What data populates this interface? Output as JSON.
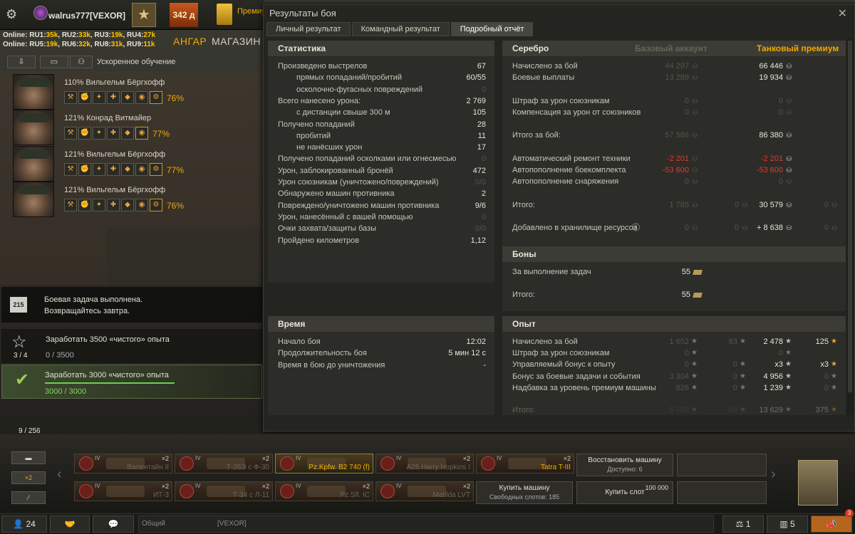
{
  "topbar": {
    "username": "walrus777[VEXOR]",
    "premium_days": "342 д",
    "premium_text": "Премиу магазин",
    "online_row1": [
      {
        "k": "RU1:",
        "v": "35k"
      },
      {
        "k": "RU2:",
        "v": "33k"
      },
      {
        "k": "RU3:",
        "v": "19k"
      },
      {
        "k": "RU4:",
        "v": "27k"
      }
    ],
    "online_row2": [
      {
        "k": "RU5:",
        "v": "19k"
      },
      {
        "k": "RU6:",
        "v": "32k"
      },
      {
        "k": "RU8:",
        "v": "31k"
      },
      {
        "k": "RU9:",
        "v": "11k"
      }
    ],
    "online_label": "Online:",
    "tab_hangar": "АНГАР",
    "tab_shop": "МАГАЗИН"
  },
  "crew_bar": {
    "accelerated": "Ускоренное обучение"
  },
  "crew": [
    {
      "name": "110% Вильгельм Бёргхофф",
      "pct": "76%"
    },
    {
      "name": "121% Конрад Витмайер",
      "pct": "77%"
    },
    {
      "name": "121% Вильгельм Бёргхофф",
      "pct": "77%"
    },
    {
      "name": "121% Вильгельм Бёргхофф",
      "pct": "76%"
    }
  ],
  "missions": {
    "daily_icon": "215",
    "daily_line1": "Боевая задача выполнена.",
    "daily_line2": "Возвращайтесь завтра.",
    "m2_title": "Заработать 3500 «чистого» опыта",
    "m2_count": "3 / 4",
    "m2_progress": "0 / 3500",
    "m3_title": "Заработать 3000 «чистого» опыта",
    "m3_progress": "3000 / 3000"
  },
  "window": {
    "title": "Результаты боя",
    "tabs": [
      "Личный результат",
      "Командный результат",
      "Подробный отчёт"
    ],
    "active_tab": 2
  },
  "stats": {
    "header": "Статистика",
    "rows": [
      {
        "label": "Произведено выстрелов",
        "value": "67",
        "indent": false,
        "dim": false
      },
      {
        "label": "прямых попаданий/пробитий",
        "value": "60/55",
        "indent": true,
        "dim": false
      },
      {
        "label": "осколочно-фугасных повреждений",
        "value": "0",
        "indent": true,
        "dim": true
      },
      {
        "label": "Всего нанесено урона:",
        "value": "2 769",
        "indent": false,
        "dim": false
      },
      {
        "label": "с дистанции свыше 300 м",
        "value": "105",
        "indent": true,
        "dim": false
      },
      {
        "label": "Получено попаданий",
        "value": "28",
        "indent": false,
        "dim": false
      },
      {
        "label": "пробитий",
        "value": "11",
        "indent": true,
        "dim": false
      },
      {
        "label": "не нанёсших урон",
        "value": "17",
        "indent": true,
        "dim": false
      },
      {
        "label": "Получено попаданий осколками или огнесмесью",
        "value": "0",
        "indent": false,
        "dim": true
      },
      {
        "label": "Урон, заблокированный бронёй",
        "value": "472",
        "indent": false,
        "dim": false
      },
      {
        "label": "Урон союзникам (уничтожено/повреждений)",
        "value": "0/0",
        "indent": false,
        "dim": true
      },
      {
        "label": "Обнаружено машин противника",
        "value": "2",
        "indent": false,
        "dim": false
      },
      {
        "label": "Повреждено/уничтожено машин противника",
        "value": "9/6",
        "indent": false,
        "dim": false
      },
      {
        "label": "Урон, нанесённый с вашей помощью",
        "value": "0",
        "indent": false,
        "dim": true
      },
      {
        "label": "Очки захвата/защиты базы",
        "value": "0/0",
        "indent": false,
        "dim": true
      },
      {
        "label": "Пройдено километров",
        "value": "1,12",
        "indent": false,
        "dim": false
      }
    ]
  },
  "time": {
    "header": "Время",
    "rows": [
      {
        "label": "Начало боя",
        "value": "12:02"
      },
      {
        "label": "Продолжительность боя",
        "value": "5 мин 12 с"
      },
      {
        "label": "Время в бою до уничтожения",
        "value": "-"
      }
    ]
  },
  "silver": {
    "header": "Серебро",
    "col_base": "Базовый аккаунт",
    "col_prem": "Танковый премиум",
    "rows": [
      {
        "label": "Начислено за бой",
        "base": "44 297",
        "prem": "66 446",
        "gap": false
      },
      {
        "label": "Боевые выплаты",
        "base": "13 289",
        "prem": "19 934",
        "gap": false
      },
      {
        "label": "Штраф за урон союзникам",
        "base": "0",
        "prem": "0",
        "gap": true
      },
      {
        "label": "Компенсация за урон от союзников",
        "base": "0",
        "prem": "0",
        "gap": false
      },
      {
        "label": "Итого за бой:",
        "base": "57 586",
        "prem": "86 380",
        "gap": true
      },
      {
        "label": "Автоматический ремонт техники",
        "base": "-2 201",
        "prem": "-2 201",
        "gap": true
      },
      {
        "label": "Автопополнение боекомплекта",
        "base": "-53 600",
        "prem": "-53 600",
        "gap": false
      },
      {
        "label": "Автопополнение снаряжения",
        "base": "0",
        "prem": "0",
        "gap": false
      },
      {
        "label": "Итого:",
        "base": "1 785",
        "base2": "0",
        "prem": "30 579",
        "prem2": "0",
        "gap": true
      },
      {
        "label": "Добавлено в хранилище ресурсов",
        "base": "0",
        "base2": "0",
        "prem": "+ 8 638",
        "prem2": "0",
        "gap": true
      }
    ]
  },
  "bons": {
    "header": "Боны",
    "rows": [
      {
        "label": "За выполнение задач",
        "value": "55"
      },
      {
        "label": "Итого:",
        "value": "55"
      }
    ]
  },
  "exp": {
    "header": "Опыт",
    "rows": [
      {
        "label": "Начислено за бой",
        "b1": "1 652",
        "b2": "83",
        "p1": "2 478",
        "p2": "125"
      },
      {
        "label": "Штраф за урон союзникам",
        "b1": "0",
        "b2": "",
        "p1": "0",
        "p2": ""
      },
      {
        "label": "Управляемый бонус к опыту",
        "b1": "0",
        "b2": "0",
        "p1": "x3",
        "p2": "x3"
      },
      {
        "label": "Бонус за боевые задачи и события",
        "b1": "3 304",
        "b2": "0",
        "p1": "4 956",
        "p2": "0"
      },
      {
        "label": "Надбавка за уровень премиум машины",
        "b1": "826",
        "b2": "0",
        "p1": "1 239",
        "p2": "0"
      },
      {
        "label": "Итого:",
        "b1": "5 782",
        "b2": "83",
        "p1": "13 629",
        "p2": "375"
      }
    ]
  },
  "carousel": {
    "slots": "9 / 256",
    "side_x2": "×2",
    "vehicles_row1": [
      {
        "tier": "IV",
        "name": "Валентайн II",
        "x2": "×2",
        "cls": ""
      },
      {
        "tier": "IV",
        "name": "Т-28Э с Ф-30",
        "x2": "×2",
        "cls": ""
      },
      {
        "tier": "IV",
        "name": "Pz.Kpfw. B2 740 (f)",
        "x2": "",
        "cls": "sel"
      },
      {
        "tier": "IV",
        "name": "A25 Harry Hopkins I",
        "x2": "×2",
        "cls": ""
      },
      {
        "tier": "IV",
        "name": "Tatra T-III",
        "x2": "×2",
        "cls": "prem"
      }
    ],
    "vehicles_row2": [
      {
        "tier": "IV",
        "name": "ИТ-3",
        "x2": "×2",
        "cls": ""
      },
      {
        "tier": "IV",
        "name": "Т-34 с Л-11",
        "x2": "×2",
        "cls": ""
      },
      {
        "tier": "IV",
        "name": "Pz.Sfl. IC",
        "x2": "×2",
        "cls": ""
      },
      {
        "tier": "IV",
        "name": "Matilda LVT",
        "x2": "×2",
        "cls": ""
      }
    ],
    "restore": {
      "label": "Восстановить машину",
      "sub": "Доступно: 6"
    },
    "buy_vehicle": {
      "label": "Купить машину",
      "sub": "Свободных слотов: 185"
    },
    "buy_slot": {
      "label": "Купить слот",
      "price": "100 000"
    }
  },
  "bottombar": {
    "players": "24",
    "chat_general": "Общий",
    "chat_clan": "[VEXOR]",
    "right1": "1",
    "right2": "5",
    "notif": "3"
  }
}
